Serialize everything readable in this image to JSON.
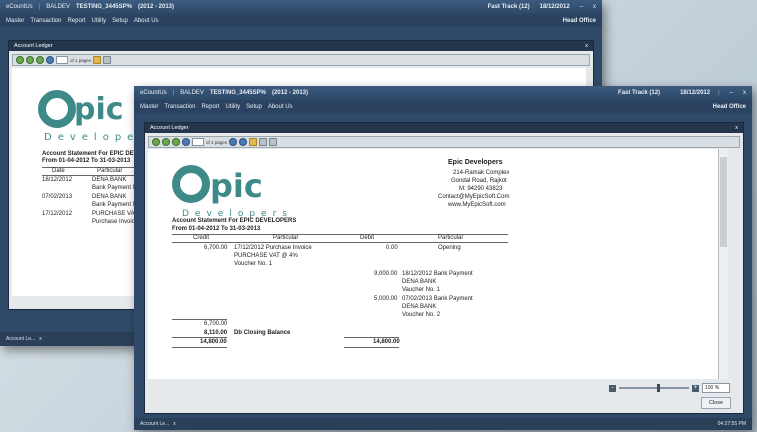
{
  "app": {
    "name": "eCountUs",
    "company_short": "BALDEV",
    "company": "TESTING_3445SP%",
    "year": "(2012 - 2013)",
    "fast_track": "Fast Track (12)",
    "date": "18/12/2012",
    "office": "Head Office",
    "minimize": "–",
    "close_x": "x"
  },
  "menu": [
    "Master",
    "Transaction",
    "Report",
    "Utility",
    "Setup",
    "About Us"
  ],
  "child_window": {
    "title": "Account Ledger",
    "close": "x"
  },
  "toolbar": {
    "page_value": "1",
    "page_label": "of 1 pages"
  },
  "logo": {
    "pic": "pic",
    "developers": "Developers"
  },
  "company_info": {
    "name": "Epic Developers",
    "addr1": "214-Ramak Complex",
    "addr2": "Gondal Road, Rajkot",
    "phone": "M: 94290 43823",
    "email": "Contact@MyEpicSoft.Com",
    "web": "www.MyEpicSoft.com"
  },
  "statement": {
    "title": "Account Statement For EPIC DEVELOPERS",
    "period": "From 01-04-2012 To 31-03-2013",
    "headers": [
      "Credit",
      "Particular",
      "Debit",
      "Particular"
    ],
    "rows": [
      {
        "credit": "6,700.00",
        "text": "17/12/2012   Purchase Invoice",
        "debit": "0.00",
        "right": "Opening"
      },
      {
        "credit": "",
        "text": "PURCHASE VAT @ 4%",
        "debit": "",
        "right": ""
      },
      {
        "credit": "",
        "text": "Voucher No. 1",
        "debit": "",
        "right": ""
      },
      {
        "credit": "",
        "text": "",
        "debit": "9,000.00",
        "right": "18/12/2012   Bank Payment"
      },
      {
        "credit": "",
        "text": "",
        "debit": "",
        "right": "DENA BANK"
      },
      {
        "credit": "",
        "text": "",
        "debit": "",
        "right": "Vaucher No. 1"
      },
      {
        "credit": "",
        "text": "",
        "debit": "5,000.00",
        "right": "07/02/2013   Bank Payment"
      },
      {
        "credit": "",
        "text": "",
        "debit": "",
        "right": "DENA BANK"
      },
      {
        "credit": "",
        "text": "",
        "debit": "",
        "right": "Voucher No. 2"
      }
    ],
    "subtotal_credit": "6,700.00",
    "closing_value": "8,110.00",
    "closing_label": "Db Closing Balance",
    "total_credit": "14,800.00",
    "total_debit": "14,800.00"
  },
  "back_statement": {
    "headers": [
      "Date",
      "Particular"
    ],
    "rows": [
      {
        "date": "18/12/2012",
        "text": "DENA BANK"
      },
      {
        "date": "",
        "text": "Bank Payment  No. 1"
      },
      {
        "date": "07/02/2013",
        "text": "DENA BANK"
      },
      {
        "date": "",
        "text": "Bank Payment  No. 2"
      },
      {
        "date": "17/12/2012",
        "text": "PURCHASE VAT @ 4%"
      },
      {
        "date": "",
        "text": "Purchase Invoice  No. 1"
      }
    ]
  },
  "zoom": {
    "value": "100 %",
    "minus": "-",
    "plus": "+"
  },
  "close_button": "Close",
  "taskbar": {
    "tab": "Account Le...",
    "tab_close": "x",
    "clock": "04:27:55 PM"
  }
}
